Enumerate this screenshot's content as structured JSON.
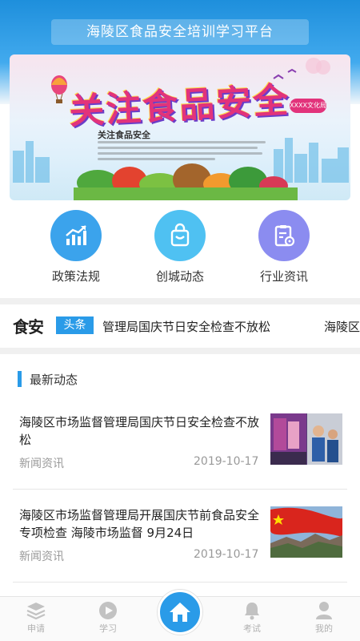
{
  "header": {
    "title": "海陵区食品安全培训学习平台"
  },
  "banner": {
    "headline": "关注食品安全",
    "subheading": "关注食品安全",
    "tag": "XXXX文化局"
  },
  "quick_nav": [
    {
      "label": "政策法规",
      "icon": "chart-icon",
      "color": "#3ba3ec"
    },
    {
      "label": "创城动态",
      "icon": "shopping-bag-icon",
      "color": "#4fc1f2"
    },
    {
      "label": "行业资讯",
      "icon": "document-settings-icon",
      "color": "#8b8cf0"
    }
  ],
  "ticker": {
    "brand": "食安",
    "tag": "头条",
    "headline": "管理局国庆节日安全检查不放松",
    "next_headline": "海陵区"
  },
  "news_section": {
    "title": "最新动态"
  },
  "news": [
    {
      "title": "海陵区市场监督管理局国庆节日安全检查不放松",
      "category": "新闻资讯",
      "date": "2019-10-17",
      "thumbnail": "inspection-photo"
    },
    {
      "title": "海陵区市场监督管理局开展国庆节前食品安全专项检查 海陵市场监督 9月24日",
      "category": "新闻资讯",
      "date": "2019-10-17",
      "thumbnail": "flag-great-wall-photo"
    }
  ],
  "tabbar": {
    "items": [
      {
        "label": "申请",
        "icon": "layers-icon"
      },
      {
        "label": "学习",
        "icon": "play-icon"
      },
      {
        "label": "",
        "icon": "home-icon"
      },
      {
        "label": "考试",
        "icon": "bell-icon"
      },
      {
        "label": "我的",
        "icon": "user-icon"
      }
    ],
    "accent": "#2a9be8"
  }
}
